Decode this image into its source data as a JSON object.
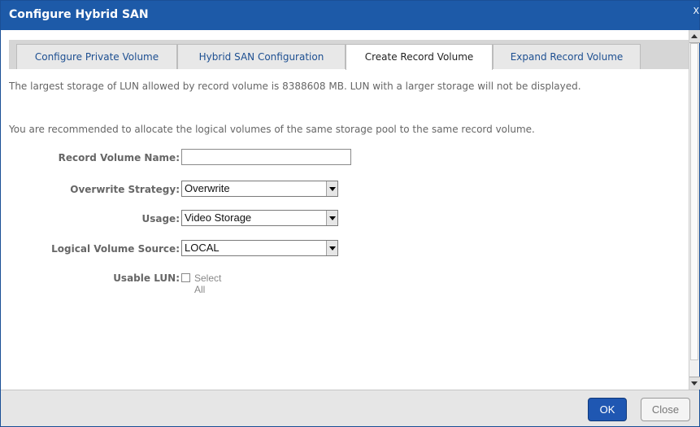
{
  "dialog": {
    "title": "Configure Hybrid SAN",
    "close_glyph": "X"
  },
  "tabs": [
    {
      "label": "Configure Private Volume",
      "active": false
    },
    {
      "label": "Hybrid SAN Configuration",
      "active": false
    },
    {
      "label": "Create Record Volume",
      "active": true
    },
    {
      "label": "Expand Record Volume",
      "active": false
    }
  ],
  "info": {
    "line1": "The largest storage of LUN allowed by record volume is 8388608 MB. LUN with a larger storage will not be displayed.",
    "line2": "You are recommended to allocate the logical volumes of the same storage pool to the same record volume."
  },
  "form": {
    "record_volume_name": {
      "label": "Record Volume Name:",
      "value": ""
    },
    "overwrite_strategy": {
      "label": "Overwrite Strategy:",
      "value": "Overwrite"
    },
    "usage": {
      "label": "Usage:",
      "value": "Video Storage"
    },
    "logical_volume_source": {
      "label": "Logical Volume Source:",
      "value": "LOCAL"
    },
    "usable_lun": {
      "label": "Usable LUN:",
      "checkbox_label": "Select All",
      "checked": false
    }
  },
  "footer": {
    "ok_label": "OK",
    "close_label": "Close"
  },
  "colors": {
    "title_bar": "#1d5aa8",
    "ok_button": "#1f57b2",
    "tab_text": "#1d4f91"
  }
}
